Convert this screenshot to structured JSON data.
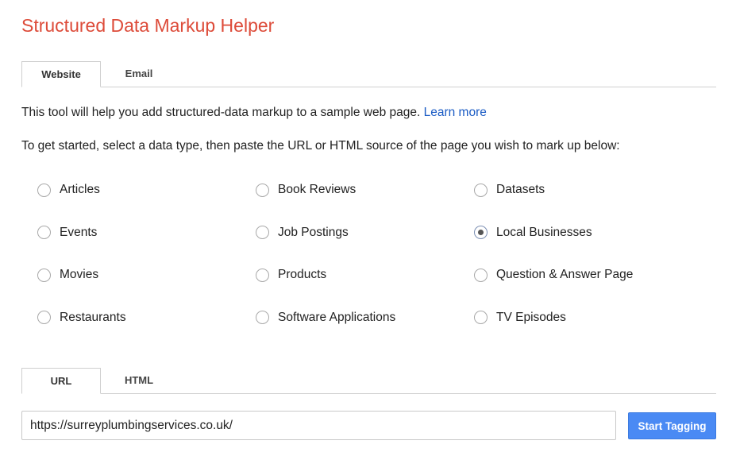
{
  "header": {
    "title": "Structured Data Markup Helper",
    "title_color": "#dd4b39"
  },
  "main_tabs": [
    {
      "label": "Website",
      "active": true
    },
    {
      "label": "Email",
      "active": false
    }
  ],
  "intro": {
    "text": "This tool will help you add structured-data markup to a sample web page. ",
    "link": "Learn more"
  },
  "instructions": "To get started, select a data type, then paste the URL or HTML source of the page you wish to mark up below:",
  "data_types": [
    {
      "label": "Articles",
      "checked": false
    },
    {
      "label": "Book Reviews",
      "checked": false
    },
    {
      "label": "Datasets",
      "checked": false
    },
    {
      "label": "Events",
      "checked": false
    },
    {
      "label": "Job Postings",
      "checked": false
    },
    {
      "label": "Local Businesses",
      "checked": true
    },
    {
      "label": "Movies",
      "checked": false
    },
    {
      "label": "Products",
      "checked": false
    },
    {
      "label": "Question & Answer Page",
      "checked": false
    },
    {
      "label": "Restaurants",
      "checked": false
    },
    {
      "label": "Software Applications",
      "checked": false
    },
    {
      "label": "TV Episodes",
      "checked": false
    }
  ],
  "source_tabs": [
    {
      "label": "URL",
      "active": true
    },
    {
      "label": "HTML",
      "active": false
    }
  ],
  "url_input": {
    "value": "https://surreyplumbingservices.co.uk/"
  },
  "start_button": {
    "label": "Start Tagging",
    "color": "#4a8af4"
  }
}
